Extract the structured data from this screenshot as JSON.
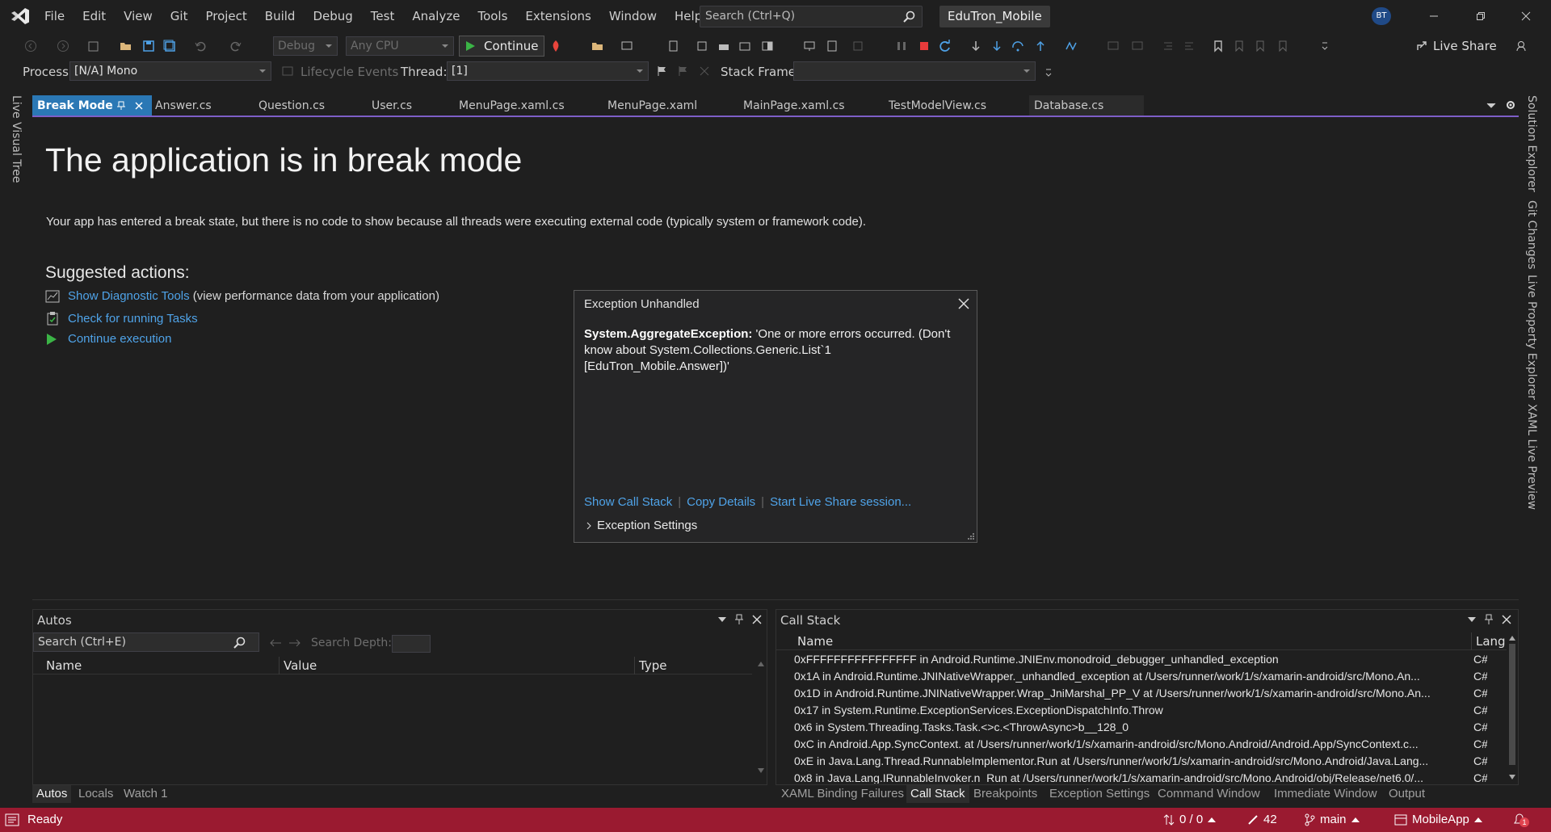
{
  "menu": [
    "File",
    "Edit",
    "View",
    "Git",
    "Project",
    "Build",
    "Debug",
    "Test",
    "Analyze",
    "Tools",
    "Extensions",
    "Window",
    "Help"
  ],
  "search": {
    "placeholder": "Search (Ctrl+Q)"
  },
  "solution_name": "EduTron_Mobile",
  "user_initials": "BT",
  "toolbar": {
    "config": "Debug",
    "platform": "Any CPU",
    "continue_label": "Continue",
    "live_share": "Live Share"
  },
  "debug_location": {
    "process_label": "Process:",
    "process_value": "[N/A] Mono",
    "lifecycle_label": "Lifecycle Events",
    "thread_label": "Thread:",
    "thread_value": "[1]",
    "stack_frame_label": "Stack Frame:"
  },
  "side_left": [
    "Live Visual Tree"
  ],
  "side_right": [
    "Solution Explorer",
    "Git Changes",
    "Live Property Explorer",
    "XAML Live Preview"
  ],
  "tabs": [
    {
      "label": "Break Mode",
      "active": true
    },
    {
      "label": "Answer.cs"
    },
    {
      "label": "Question.cs"
    },
    {
      "label": "User.cs"
    },
    {
      "label": "MenuPage.xaml.cs"
    },
    {
      "label": "MenuPage.xaml"
    },
    {
      "label": "MainPage.xaml.cs"
    },
    {
      "label": "TestModelView.cs"
    },
    {
      "label": "Database.cs"
    }
  ],
  "break_mode": {
    "title": "The application is in break mode",
    "description": "Your app has entered a break state, but there is no code to show because all threads were executing external code (typically system or framework code).",
    "suggested_heading": "Suggested actions:",
    "actions": [
      {
        "link": "Show Diagnostic Tools",
        "note": " (view performance data from your application)"
      },
      {
        "link": "Check for running Tasks",
        "note": ""
      },
      {
        "link": "Continue execution",
        "note": ""
      }
    ]
  },
  "exception": {
    "title": "Exception Unhandled",
    "type": "System.AggregateException:",
    "message": " 'One or more errors occurred. (Don't know about System.Collections.Generic.List`1 [EduTron_Mobile.Answer])'",
    "links": [
      "Show Call Stack",
      "Copy Details",
      "Start Live Share session..."
    ],
    "settings_label": "Exception Settings"
  },
  "autos": {
    "title": "Autos",
    "search_placeholder": "Search (Ctrl+E)",
    "search_depth_label": "Search Depth:",
    "columns": [
      "Name",
      "Value",
      "Type"
    ],
    "tabs": [
      "Autos",
      "Locals",
      "Watch 1"
    ]
  },
  "call_stack": {
    "title": "Call Stack",
    "columns": [
      "Name",
      "Lang"
    ],
    "rows": [
      {
        "name": "0xFFFFFFFFFFFFFFFF in Android.Runtime.JNIEnv.monodroid_debugger_unhandled_exception",
        "lang": "C#"
      },
      {
        "name": "0x1A in Android.Runtime.JNINativeWrapper._unhandled_exception at /Users/runner/work/1/s/xamarin-android/src/Mono.An...",
        "lang": "C#"
      },
      {
        "name": "0x1D in Android.Runtime.JNINativeWrapper.Wrap_JniMarshal_PP_V at /Users/runner/work/1/s/xamarin-android/src/Mono.An...",
        "lang": "C#"
      },
      {
        "name": "0x17 in System.Runtime.ExceptionServices.ExceptionDispatchInfo.Throw",
        "lang": "C#"
      },
      {
        "name": "0x6 in System.Threading.Tasks.Task.<>c.<ThrowAsync>b__128_0",
        "lang": "C#"
      },
      {
        "name": "0xC in Android.App.SyncContext. at /Users/runner/work/1/s/xamarin-android/src/Mono.Android/Android.App/SyncContext.c...",
        "lang": "C#"
      },
      {
        "name": "0xE in Java.Lang.Thread.RunnableImplementor.Run at /Users/runner/work/1/s/xamarin-android/src/Mono.Android/Java.Lang...",
        "lang": "C#"
      },
      {
        "name": "0x8 in Java.Lang.IRunnableInvoker.n_Run at /Users/runner/work/1/s/xamarin-android/src/Mono.Android/obj/Release/net6.0/...",
        "lang": "C#"
      }
    ],
    "tabs": [
      "XAML Binding Failures",
      "Call Stack",
      "Breakpoints",
      "Exception Settings",
      "Command Window",
      "Immediate Window",
      "Output"
    ]
  },
  "status": {
    "ready": "Ready",
    "sync": "0 / 0",
    "edits": "42",
    "branch": "main",
    "repo": "MobileApp",
    "notifications": "1"
  },
  "colors": {
    "statusbar": "#9a1a30",
    "accent_tab": "#2b78b5",
    "link": "#4fa3e8",
    "tab_underline": "#7e5ec7"
  }
}
